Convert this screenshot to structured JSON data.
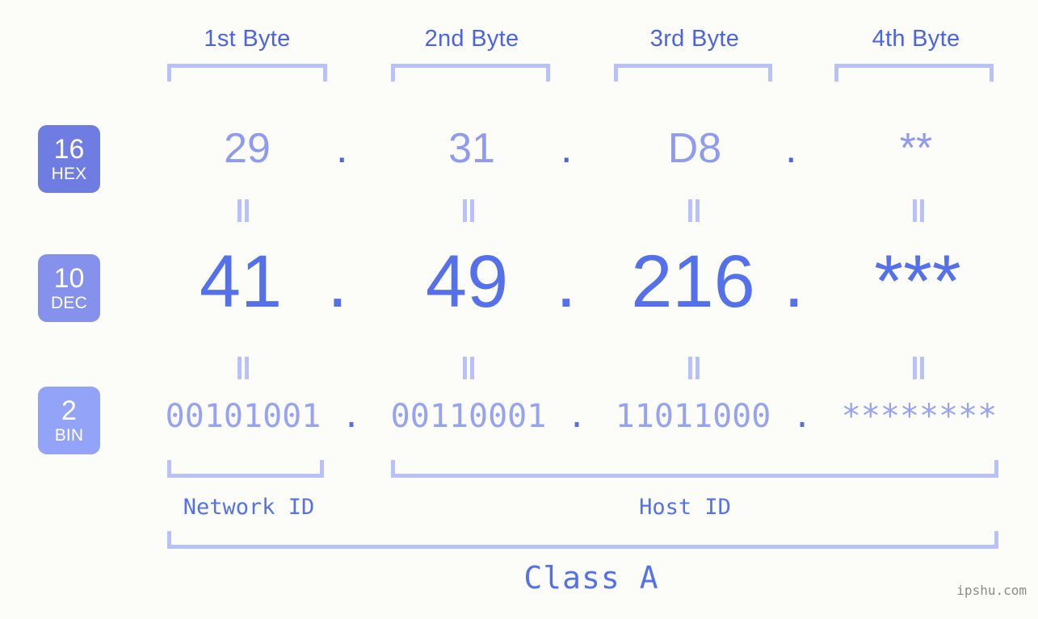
{
  "page": {
    "background_color": "#fcfdf8",
    "accent_color": "#5470ea",
    "muted_accent_color": "#b8c1fb"
  },
  "headers": {
    "bytes": [
      {
        "label": "1st Byte"
      },
      {
        "label": "2nd Byte"
      },
      {
        "label": "3rd Byte"
      },
      {
        "label": "4th Byte"
      }
    ]
  },
  "bases": [
    {
      "number": "16",
      "name": "HEX",
      "color": "#6f7ce2"
    },
    {
      "number": "10",
      "name": "DEC",
      "color": "#8591ea"
    },
    {
      "number": "2",
      "name": "BIN",
      "color": "#93a3f7"
    }
  ],
  "rows": {
    "hex": {
      "values": [
        "29",
        "31",
        "D8",
        "**"
      ],
      "separator": "."
    },
    "dec": {
      "values": [
        "41",
        "49",
        "216",
        "***"
      ],
      "separator": "."
    },
    "bin": {
      "values": [
        "00101001",
        "00110001",
        "11011000",
        "********"
      ],
      "separator": "."
    }
  },
  "connectors": {
    "symbol": "="
  },
  "segments": {
    "network_id": "Network ID",
    "host_id": "Host ID",
    "class": "Class A"
  },
  "watermark": "ipshu.com"
}
